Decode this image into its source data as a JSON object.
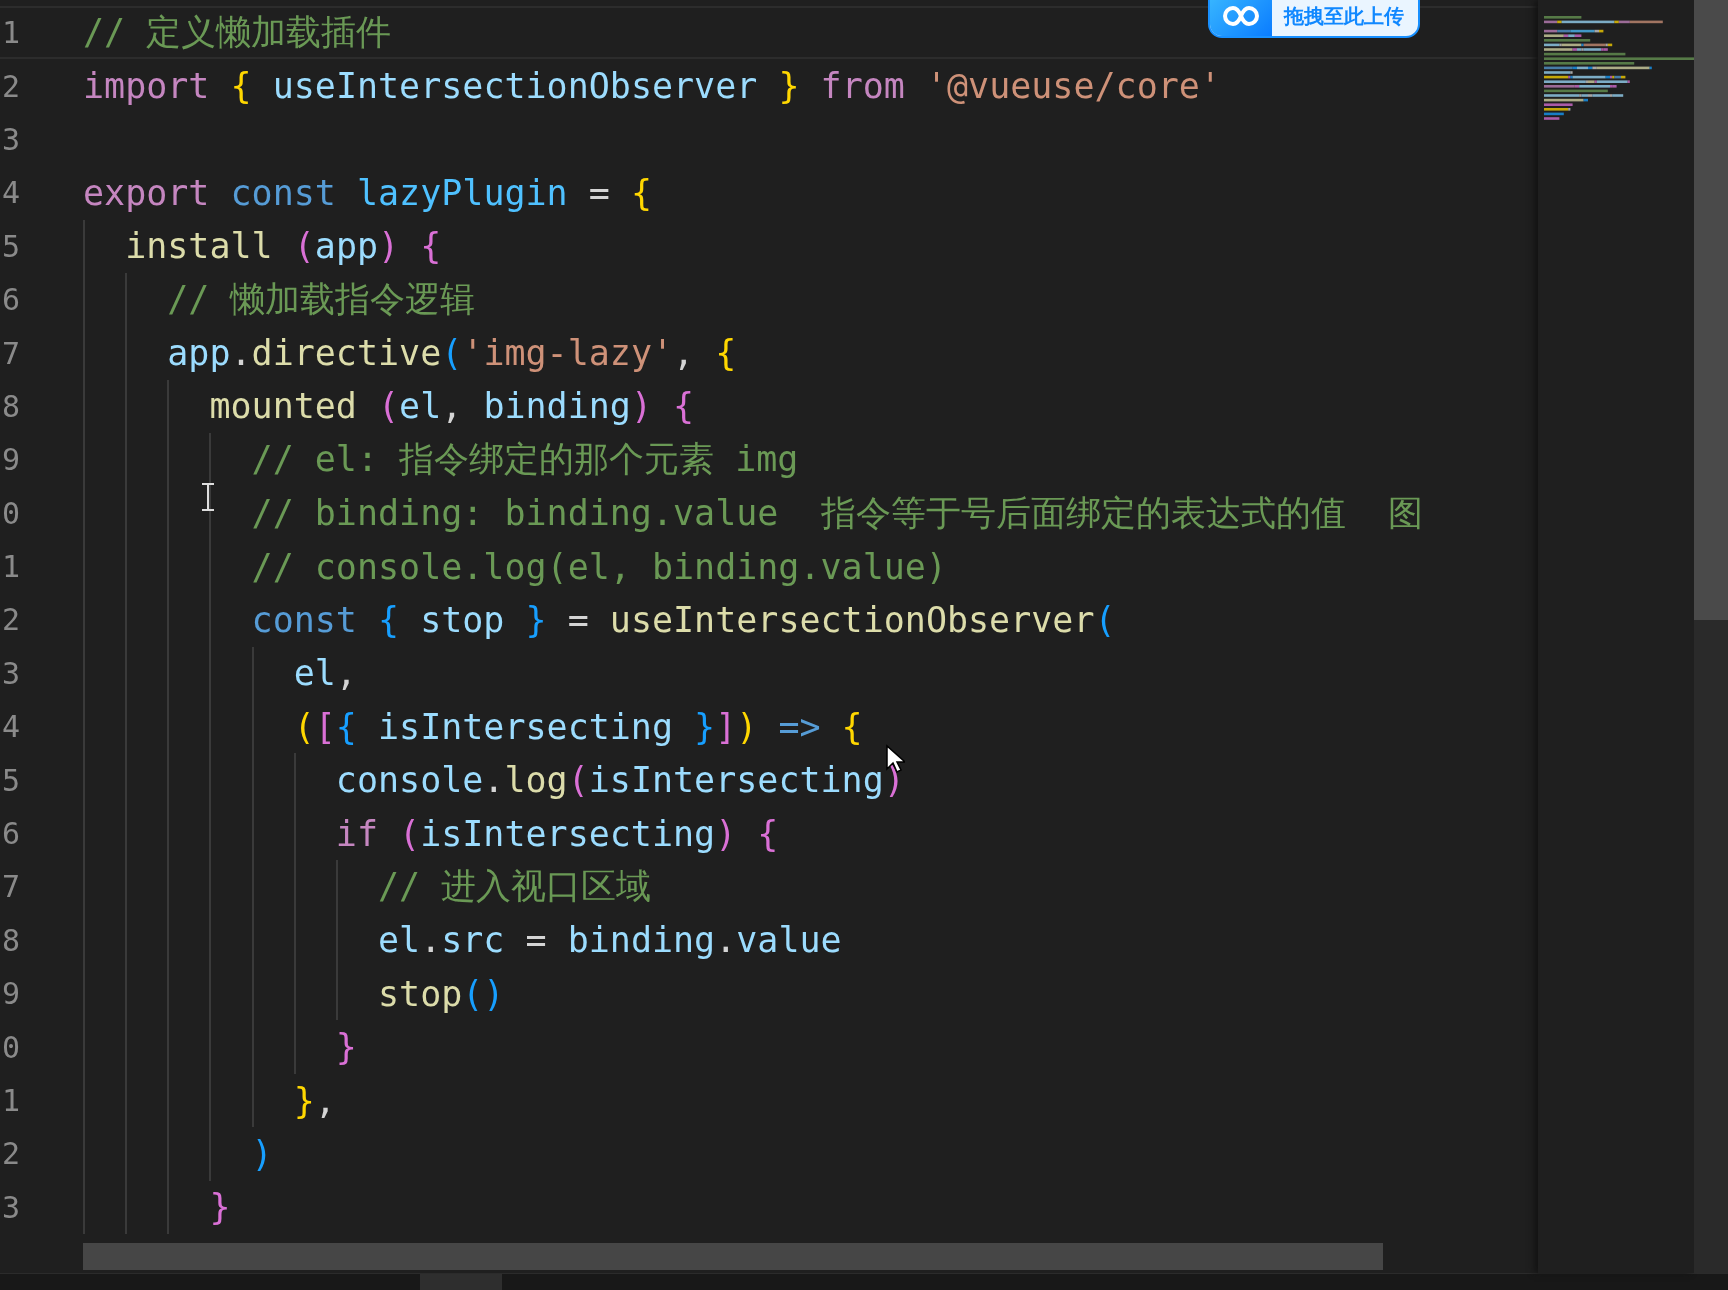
{
  "upload_badge": {
    "label": "拖拽至此上传"
  },
  "lines": [
    {
      "number": "1",
      "current": true,
      "tokens": [
        {
          "text": "// 定义懒加载插件",
          "kind": "comment"
        }
      ]
    },
    {
      "number": "2",
      "current": false,
      "tokens": [
        {
          "text": "import",
          "kind": "keyword"
        },
        {
          "text": " {",
          "kind": "bracket1"
        },
        {
          "text": " useIntersectionObserver",
          "kind": "variable"
        },
        {
          "text": " }",
          "kind": "bracket1"
        },
        {
          "text": " from",
          "kind": "keyword"
        },
        {
          "text": " '@vueuse/core'",
          "kind": "string"
        }
      ]
    },
    {
      "number": "3",
      "current": false
    },
    {
      "number": "4",
      "current": false,
      "tokens": [
        {
          "text": "export",
          "kind": "keyword"
        },
        {
          "text": " const",
          "kind": "storage"
        },
        {
          "text": " lazyPlugin",
          "kind": "constant"
        },
        {
          "text": " ="
        },
        {
          "text": " {",
          "kind": "bracket1"
        }
      ]
    },
    {
      "number": "5",
      "current": false,
      "tokens": [
        {
          "text": "  install",
          "kind": "function"
        },
        {
          "text": " (",
          "kind": "bracket2"
        },
        {
          "text": "app",
          "kind": "variable"
        },
        {
          "text": ")",
          "kind": "bracket2"
        },
        {
          "text": " {",
          "kind": "bracket2"
        }
      ]
    },
    {
      "number": "6",
      "current": false,
      "tokens": [
        {
          "text": "    // 懒加载指令逻辑",
          "kind": "comment"
        }
      ]
    },
    {
      "number": "7",
      "current": false,
      "tokens": [
        {
          "text": "    app",
          "kind": "variable"
        },
        {
          "text": "."
        },
        {
          "text": "directive",
          "kind": "function"
        },
        {
          "text": "(",
          "kind": "bracket3"
        },
        {
          "text": "'img-lazy'",
          "kind": "string"
        },
        {
          "text": ","
        },
        {
          "text": " {",
          "kind": "bracket1"
        }
      ]
    },
    {
      "number": "8",
      "current": false,
      "tokens": [
        {
          "text": "      mounted",
          "kind": "function"
        },
        {
          "text": " (",
          "kind": "bracket2"
        },
        {
          "text": "el",
          "kind": "variable"
        },
        {
          "text": ","
        },
        {
          "text": " binding",
          "kind": "variable"
        },
        {
          "text": ")",
          "kind": "bracket2"
        },
        {
          "text": " {",
          "kind": "bracket2"
        }
      ]
    },
    {
      "number": "9",
      "current": false,
      "tokens": [
        {
          "text": "        // el: 指令绑定的那个元素 img",
          "kind": "comment"
        }
      ]
    },
    {
      "number": "0",
      "current": false,
      "tokens": [
        {
          "text": "        // binding: binding.value  指令等于号后面绑定的表达式的值  图",
          "kind": "comment"
        }
      ]
    },
    {
      "number": "1",
      "current": false,
      "tokens": [
        {
          "text": "        // console.log(el, binding.value)",
          "kind": "comment"
        }
      ]
    },
    {
      "number": "2",
      "current": false,
      "tokens": [
        {
          "text": "        const",
          "kind": "storage"
        },
        {
          "text": " {",
          "kind": "bracket3"
        },
        {
          "text": " stop",
          "kind": "variable"
        },
        {
          "text": " }",
          "kind": "bracket3"
        },
        {
          "text": " ="
        },
        {
          "text": " useIntersectionObserver",
          "kind": "function"
        },
        {
          "text": "(",
          "kind": "bracket3"
        }
      ]
    },
    {
      "number": "3",
      "current": false,
      "tokens": [
        {
          "text": "          el",
          "kind": "variable"
        },
        {
          "text": ","
        }
      ]
    },
    {
      "number": "4",
      "current": false,
      "tokens": [
        {
          "text": "          (",
          "kind": "bracket1"
        },
        {
          "text": "[",
          "kind": "bracket2"
        },
        {
          "text": "{",
          "kind": "bracket3"
        },
        {
          "text": " isIntersecting",
          "kind": "variable"
        },
        {
          "text": " }",
          "kind": "bracket3"
        },
        {
          "text": "]",
          "kind": "bracket2"
        },
        {
          "text": ")",
          "kind": "bracket1"
        },
        {
          "text": " =>",
          "kind": "storage"
        },
        {
          "text": " {",
          "kind": "bracket1"
        }
      ]
    },
    {
      "number": "5",
      "current": false,
      "tokens": [
        {
          "text": "            console",
          "kind": "variable"
        },
        {
          "text": "."
        },
        {
          "text": "log",
          "kind": "function"
        },
        {
          "text": "(",
          "kind": "bracket2"
        },
        {
          "text": "isIntersecting",
          "kind": "variable"
        },
        {
          "text": ")",
          "kind": "bracket2"
        }
      ]
    },
    {
      "number": "6",
      "current": false,
      "tokens": [
        {
          "text": "            if",
          "kind": "keyword"
        },
        {
          "text": " (",
          "kind": "bracket2"
        },
        {
          "text": "isIntersecting",
          "kind": "variable"
        },
        {
          "text": ")",
          "kind": "bracket2"
        },
        {
          "text": " {",
          "kind": "bracket2"
        }
      ]
    },
    {
      "number": "7",
      "current": false,
      "tokens": [
        {
          "text": "              // 进入视口区域",
          "kind": "comment"
        }
      ]
    },
    {
      "number": "8",
      "current": false,
      "tokens": [
        {
          "text": "              el",
          "kind": "variable"
        },
        {
          "text": "."
        },
        {
          "text": "src",
          "kind": "variable"
        },
        {
          "text": " ="
        },
        {
          "text": " binding",
          "kind": "variable"
        },
        {
          "text": "."
        },
        {
          "text": "value",
          "kind": "variable"
        }
      ]
    },
    {
      "number": "9",
      "current": false,
      "tokens": [
        {
          "text": "              stop",
          "kind": "function"
        },
        {
          "text": "()",
          "kind": "bracket3"
        }
      ]
    },
    {
      "number": "0",
      "current": false,
      "tokens": [
        {
          "text": "            }",
          "kind": "bracket2"
        }
      ]
    },
    {
      "number": "1",
      "current": false,
      "tokens": [
        {
          "text": "          }",
          "kind": "bracket1"
        },
        {
          "text": ","
        }
      ]
    },
    {
      "number": "2",
      "current": false,
      "tokens": [
        {
          "text": "        )",
          "kind": "bracket3"
        }
      ]
    },
    {
      "number": "3",
      "current": false,
      "tokens": [
        {
          "text": "      }",
          "kind": "bracket2"
        }
      ]
    }
  ]
}
